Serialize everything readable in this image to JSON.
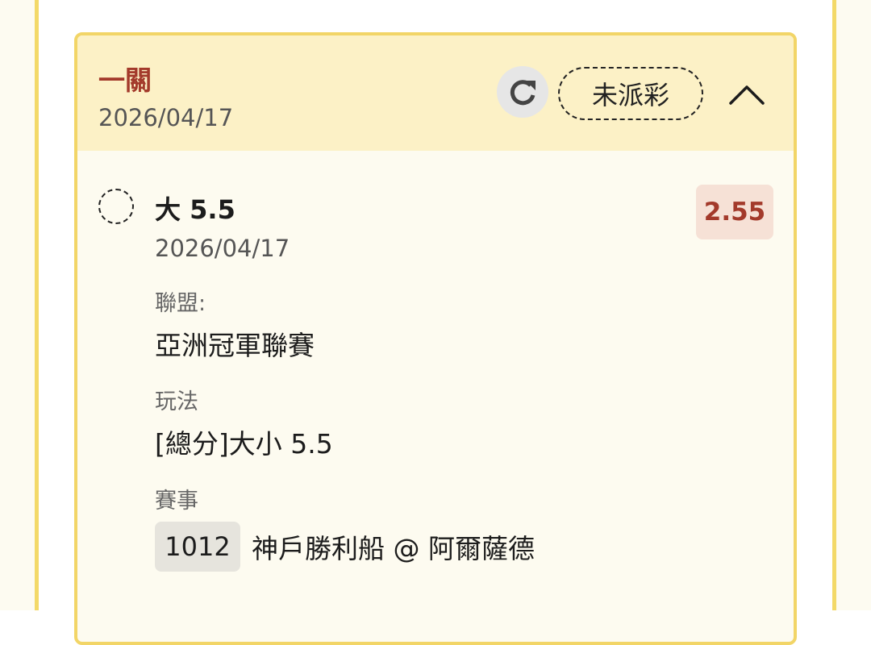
{
  "header": {
    "title": "一關",
    "date": "2026/04/17",
    "status": "未派彩"
  },
  "selection": {
    "title": "大 5.5",
    "date": "2026/04/17",
    "odds": "2.55",
    "league_label": "聯盟:",
    "league_value": "亞洲冠軍聯賽",
    "market_label": "玩法",
    "market_value": "[總分]大小 5.5",
    "event_label": "賽事",
    "event_code": "1012",
    "event_name": "神戶勝利船 @ 阿爾薩德"
  },
  "icons": {
    "refresh": "refresh-icon",
    "collapse": "chevron-up-icon"
  },
  "colors": {
    "accent": "#a33a2b",
    "border": "#f2d567",
    "header_bg": "#fcf1c6",
    "body_bg": "#fdfbf0",
    "odds_bg": "#f6e1d6"
  }
}
